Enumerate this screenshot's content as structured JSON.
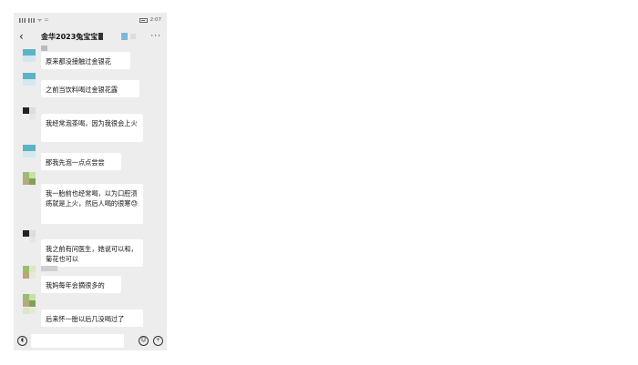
{
  "status_bar": {
    "left_text": "",
    "time": "2:07"
  },
  "header": {
    "back_icon": "chevron-left-icon",
    "title": "金华2023兔宝宝",
    "more_icon": "more-dots-icon"
  },
  "messages": [
    {
      "text": "原来都没接触过金银花"
    },
    {
      "text": "之前当饮料喝过金银花露"
    },
    {
      "text": "我经常泡茶喝，因为我很会上火"
    },
    {
      "text": "那我先泡一点点尝尝"
    },
    {
      "text": "我一胎前也经常喝，以为口腔溃疡就是上火，然后人喝的很寒😓"
    },
    {
      "text": "我之前有问医生，她说可以和，菊花也可以"
    },
    {
      "text": "我妈每年会摘很多的"
    },
    {
      "text": "后来怀一胎以后几没喝过了"
    }
  ],
  "input_bar": {
    "voice_icon": "voice-icon",
    "emoji_icon": "emoji-icon",
    "plus_icon": "plus-icon"
  }
}
